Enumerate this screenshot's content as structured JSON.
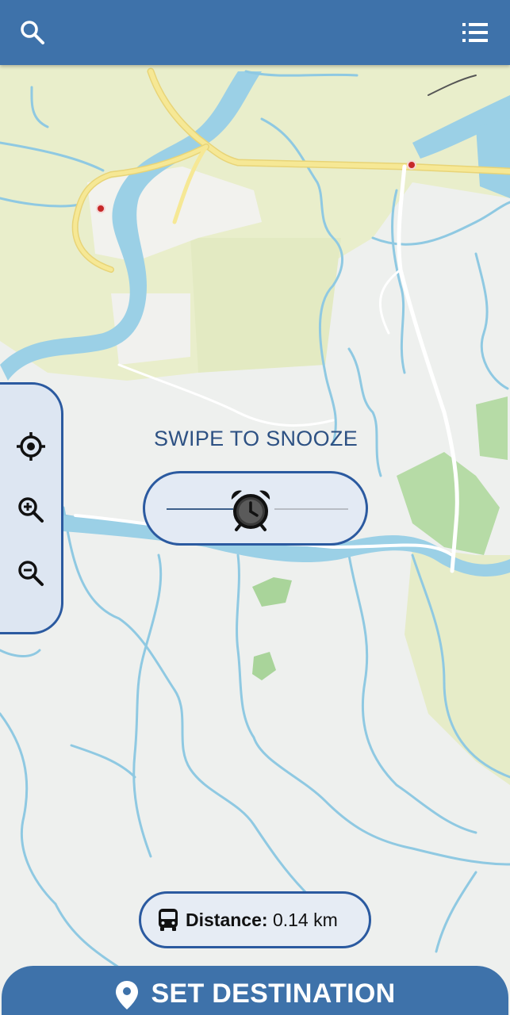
{
  "app": {
    "toolbar": {
      "search_icon": "search-icon",
      "menu_icon": "list-menu-icon"
    },
    "map_controls": {
      "locate_icon": "crosshair-icon",
      "zoom_in_icon": "zoom-in-icon",
      "zoom_out_icon": "zoom-out-icon"
    },
    "snooze": {
      "label": "SWIPE TO SNOOZE",
      "handle_icon": "alarm-clock-icon"
    },
    "distance": {
      "icon": "bus-icon",
      "label": "Distance:",
      "value": "0.14 km"
    },
    "set_destination": {
      "icon": "location-pin-icon",
      "label": "SET DESTINATION"
    },
    "colors": {
      "primary": "#3e72aa",
      "border": "#2b5aa0",
      "text_accent": "#2d5183",
      "water": "#8fc9e2",
      "road": "#f2e08a",
      "park": "#a9d49a",
      "land_tint": "#e6edc8"
    }
  }
}
